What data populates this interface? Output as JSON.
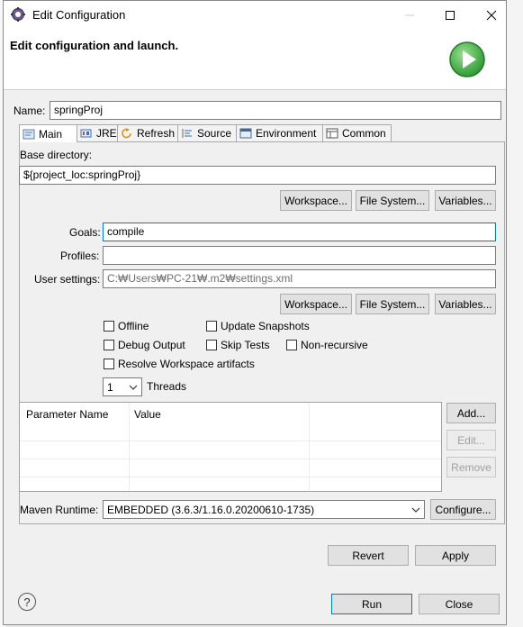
{
  "window": {
    "title": "Edit Configuration",
    "header_title": "Edit configuration and launch."
  },
  "name": {
    "label": "Name:",
    "value": "springProj"
  },
  "tabs": [
    {
      "label": "Main",
      "icon": "maven-main-icon"
    },
    {
      "label": "JRE",
      "icon": "jre-icon"
    },
    {
      "label": "Refresh",
      "icon": "refresh-icon"
    },
    {
      "label": "Source",
      "icon": "source-icon"
    },
    {
      "label": "Environment",
      "icon": "environment-icon"
    },
    {
      "label": "Common",
      "icon": "common-icon"
    }
  ],
  "main": {
    "base_dir_label": "Base directory:",
    "base_dir_value": "${project_loc:springProj}",
    "buttons1": {
      "workspace": "Workspace...",
      "filesystem": "File System...",
      "variables": "Variables..."
    },
    "goals_label": "Goals:",
    "goals_value": "compile",
    "profiles_label": "Profiles:",
    "profiles_value": "",
    "user_settings_label": "User settings:",
    "user_settings_value": "C:₩Users₩PC-21₩.m2₩settings.xml",
    "buttons2": {
      "workspace": "Workspace...",
      "filesystem": "File System...",
      "variables": "Variables..."
    },
    "checkboxes": {
      "offline": "Offline",
      "update_snapshots": "Update Snapshots",
      "debug_output": "Debug Output",
      "skip_tests": "Skip Tests",
      "non_recursive": "Non-recursive",
      "resolve_workspace": "Resolve Workspace artifacts"
    },
    "threads_value": "1",
    "threads_label": "Threads",
    "param_table": {
      "col_name": "Parameter Name",
      "col_value": "Value"
    },
    "table_buttons": {
      "add": "Add...",
      "edit": "Edit...",
      "remove": "Remove"
    },
    "runtime_label": "Maven Runtime:",
    "runtime_value": "EMBEDDED (3.6.3/1.16.0.20200610-1735)",
    "configure": "Configure..."
  },
  "footer": {
    "revert": "Revert",
    "apply": "Apply",
    "run": "Run",
    "close": "Close",
    "help": "?"
  },
  "colors": {
    "accent": "#0078d7",
    "run_green": "#3aa843"
  }
}
